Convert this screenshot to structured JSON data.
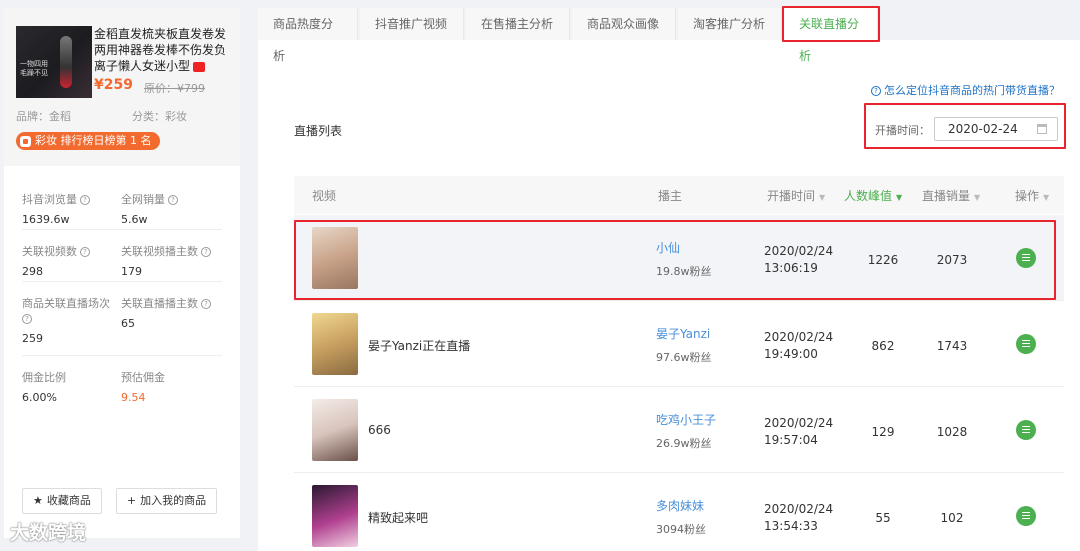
{
  "product": {
    "title": "金稻直发梳夹板直发卷发两用神器卷发棒不伤发负离子懒人女迷小型",
    "price": "¥259",
    "original_price": "原价：¥799",
    "brand": "品牌：金稻",
    "category": "分类：彩妆",
    "rank_badge": "彩妆 排行榜日榜第 1 名",
    "thumb_caption": "一物四用 毛躁不见"
  },
  "stats": [
    {
      "label": "抖音浏览量",
      "value": "1639.6w"
    },
    {
      "label": "全网销量",
      "value": "5.6w"
    },
    {
      "label": "关联视频数",
      "value": "298"
    },
    {
      "label": "关联视频播主数",
      "value": "179"
    },
    {
      "label": "商品关联直播场次",
      "value": "259"
    },
    {
      "label": "关联直播播主数",
      "value": "65"
    },
    {
      "label": "佣金比例",
      "value": "6.00%"
    },
    {
      "label": "预估佣金",
      "value": "9.54"
    }
  ],
  "buttons": {
    "favorite": "收藏商品",
    "add": "加入我的商品"
  },
  "watermark": "大数跨境",
  "tabs": [
    "商品热度分析",
    "抖音推广视频",
    "在售播主分析",
    "商品观众画像",
    "淘客推广分析",
    "关联直播分析"
  ],
  "active_tab": "关联直播分析",
  "help_link": "怎么定位抖音商品的热门带货直播？",
  "list_title": "直播列表",
  "date_filter": {
    "label": "开播时间：",
    "value": "2020-02-24"
  },
  "columns": [
    "视频",
    "播主",
    "开播时间",
    "人数峰值",
    "直播销量",
    "操作"
  ],
  "rows": [
    {
      "title": "",
      "anchor": "小仙",
      "fans": "19.8w粉丝",
      "date": "2020/02/24",
      "time": "13:06:19",
      "peak": "1226",
      "sales": "2073"
    },
    {
      "title": "晏子Yanzi正在直播",
      "anchor": "晏子Yanzi",
      "fans": "97.6w粉丝",
      "date": "2020/02/24",
      "time": "19:49:00",
      "peak": "862",
      "sales": "1743"
    },
    {
      "title": "666",
      "anchor": "吃鸡小王子",
      "fans": "26.9w粉丝",
      "date": "2020/02/24",
      "time": "19:57:04",
      "peak": "129",
      "sales": "1028"
    },
    {
      "title": "精致起来吧",
      "anchor": "多肉妹妹",
      "fans": "3094粉丝",
      "date": "2020/02/24",
      "time": "13:54:33",
      "peak": "55",
      "sales": "102"
    }
  ],
  "colors": {
    "accent": "#4caf50",
    "highlight": "#e8242f",
    "price": "#f26a2e",
    "link": "#4a90d9"
  }
}
